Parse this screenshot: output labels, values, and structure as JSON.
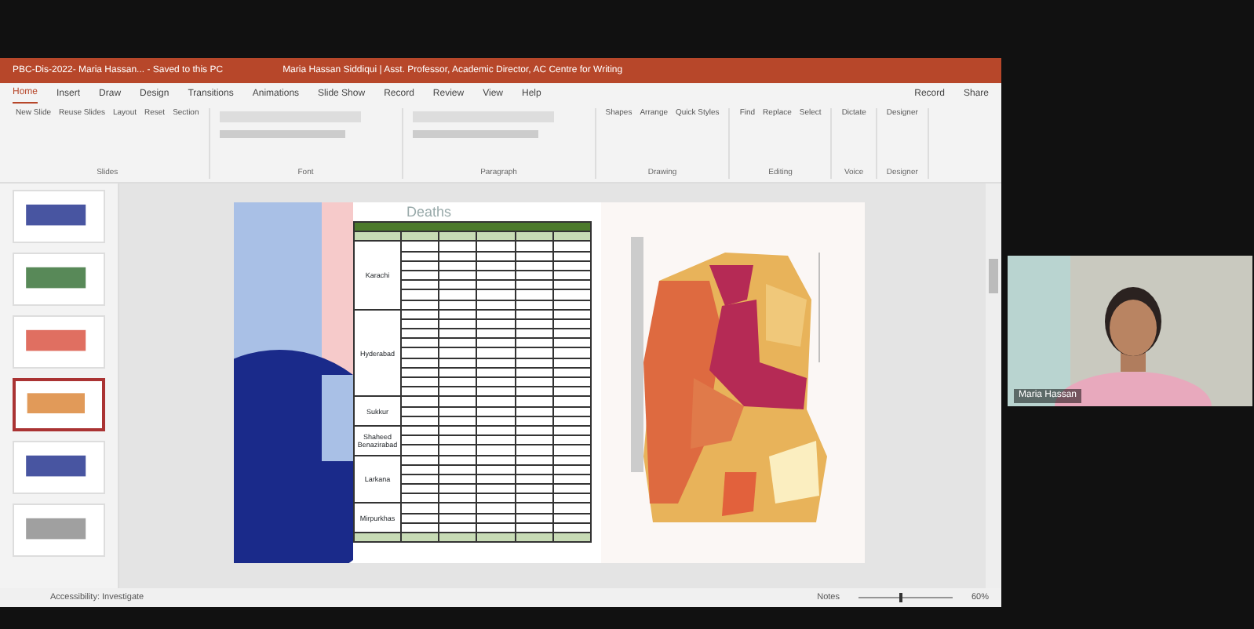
{
  "window": {
    "title": "PBC-Dis-2022- Maria Hassan... - Saved to this PC",
    "account": "Maria Hassan Siddiqui | Asst. Professor, Academic Director, AC Centre for Writing"
  },
  "tabs": [
    {
      "label": "Home",
      "selected": true
    },
    {
      "label": "Insert",
      "selected": false
    },
    {
      "label": "Draw",
      "selected": false
    },
    {
      "label": "Design",
      "selected": false
    },
    {
      "label": "Transitions",
      "selected": false
    },
    {
      "label": "Animations",
      "selected": false
    },
    {
      "label": "Slide Show",
      "selected": false
    },
    {
      "label": "Record",
      "selected": false
    },
    {
      "label": "Review",
      "selected": false
    },
    {
      "label": "View",
      "selected": false
    },
    {
      "label": "Help",
      "selected": false
    }
  ],
  "top_actions": [
    "Record",
    "Share"
  ],
  "groups": [
    {
      "label": "Slides",
      "buttons": [
        "New Slide",
        "Reuse Slides",
        "Layout",
        "Reset",
        "Section"
      ]
    },
    {
      "label": "Font"
    },
    {
      "label": "Paragraph"
    },
    {
      "label": "Drawing",
      "buttons": [
        "Shapes",
        "Arrange",
        "Quick Styles"
      ]
    },
    {
      "label": "Editing",
      "buttons": [
        "Find",
        "Replace",
        "Select"
      ]
    },
    {
      "label": "Voice",
      "buttons": [
        "Dictate"
      ]
    },
    {
      "label": "Designer",
      "buttons": [
        "Designer"
      ]
    }
  ],
  "thumbnails": [
    {
      "kind": "arch",
      "selected": false
    },
    {
      "kind": "table",
      "selected": false
    },
    {
      "kind": "map",
      "selected": false
    },
    {
      "kind": "tablemap",
      "selected": true
    },
    {
      "kind": "figures",
      "selected": false
    },
    {
      "kind": "text",
      "selected": false
    }
  ],
  "slide": {
    "title": "Deaths",
    "table": {
      "divisions": [
        {
          "name": "Karachi",
          "districts": [
            {
              "kind": "row"
            },
            {
              "kind": "row"
            },
            {
              "kind": "row"
            },
            {
              "kind": "row"
            },
            {
              "kind": "row"
            },
            {
              "kind": "row"
            },
            {
              "kind": "row"
            }
          ]
        },
        {
          "name": "Hyderabad",
          "districts": [
            {
              "kind": "row"
            },
            {
              "kind": "row"
            },
            {
              "kind": "row"
            },
            {
              "kind": "row"
            },
            {
              "kind": "row"
            },
            {
              "kind": "row"
            },
            {
              "kind": "row"
            },
            {
              "kind": "row"
            },
            {
              "kind": "row"
            }
          ]
        },
        {
          "name": "Sukkur",
          "districts": [
            {
              "kind": "row"
            },
            {
              "kind": "row"
            },
            {
              "kind": "row"
            }
          ]
        },
        {
          "name": "Shaheed Benazirabad",
          "districts": [
            {
              "kind": "row"
            },
            {
              "kind": "row"
            },
            {
              "kind": "row"
            }
          ]
        },
        {
          "name": "Larkana",
          "districts": [
            {
              "kind": "row"
            },
            {
              "kind": "row"
            },
            {
              "kind": "row"
            },
            {
              "kind": "row"
            },
            {
              "kind": "row"
            }
          ]
        },
        {
          "name": "Mirpurkhas",
          "districts": [
            {
              "kind": "row"
            },
            {
              "kind": "row"
            },
            {
              "kind": "row"
            }
          ]
        }
      ]
    }
  },
  "status_bar": {
    "left": "Accessibility: Investigate",
    "notes": "Notes",
    "zoom": "60%",
    "zoom_slider": {
      "level": 0.45
    }
  },
  "participant": {
    "name": "Maria Hassan"
  }
}
